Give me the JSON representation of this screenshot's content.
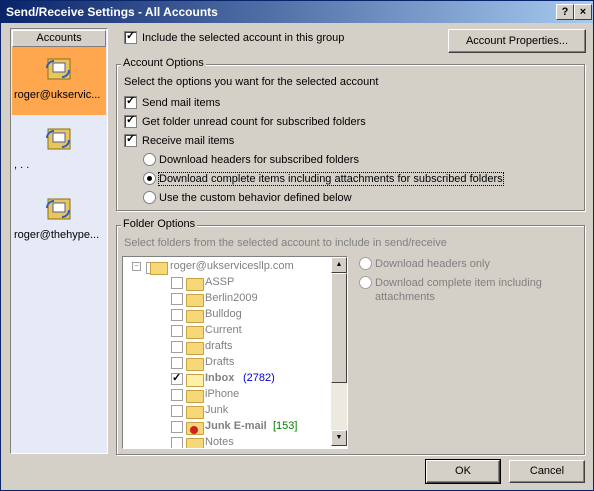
{
  "window": {
    "title": "Send/Receive Settings - All Accounts",
    "help_label": "?",
    "close_label": "×"
  },
  "sidebar": {
    "header": "Accounts",
    "items": [
      {
        "label": "roger@ukservic..."
      },
      {
        "label": ",  .   ."
      },
      {
        "label": "roger@thehype..."
      }
    ]
  },
  "include": {
    "label": "Include the selected account in this group",
    "checked": true
  },
  "account_properties_label": "Account Properties...",
  "account_options": {
    "title": "Account Options",
    "intro": "Select the options you want for the selected account",
    "send_mail": "Send mail items",
    "folder_unread": "Get folder unread count for subscribed folders",
    "receive_mail": "Receive mail items",
    "radio_headers": "Download headers for subscribed folders",
    "radio_complete": "Download complete items including attachments for subscribed folders",
    "radio_custom": "Use the custom behavior defined below"
  },
  "folder_options": {
    "title": "Folder Options",
    "intro": "Select folders from the selected account to include in send/receive",
    "root": "roger@ukservicesllp.com",
    "folders": [
      {
        "name": "ASSP"
      },
      {
        "name": "Berlin2009"
      },
      {
        "name": "Bulldog"
      },
      {
        "name": "Current"
      },
      {
        "name": "drafts"
      },
      {
        "name": "Drafts"
      },
      {
        "name": "Inbox",
        "count": "(2782)",
        "checked": true,
        "bold": true
      },
      {
        "name": "iPhone"
      },
      {
        "name": "Junk"
      },
      {
        "name": "Junk E-mail",
        "count": "[153]",
        "bold": true
      },
      {
        "name": "Notes"
      }
    ],
    "download_headers_only": "Download headers only",
    "download_complete_line1": "Download complete item including",
    "download_complete_line2": "attachments"
  },
  "ok_label": "OK",
  "cancel_label": "Cancel"
}
